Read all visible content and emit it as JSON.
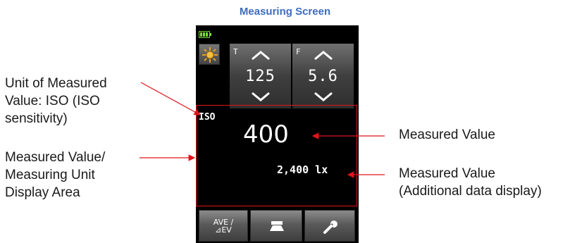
{
  "header": {
    "title": "Measuring Screen"
  },
  "callouts": {
    "unit_label": [
      "Unit of Measured",
      "Value: ISO (ISO",
      "sensitivity)"
    ],
    "display_area": [
      "Measured Value/",
      "Measuring Unit",
      "Display Area"
    ],
    "measured_value": "Measured Value",
    "additional": [
      "Measured Value",
      "(Additional data display)"
    ]
  },
  "device": {
    "shutter": {
      "label": "T",
      "value": "125"
    },
    "aperture": {
      "label": "F",
      "value": "5.6"
    },
    "unit": "ISO",
    "measured_value": "400",
    "additional_value": "2,400 lx",
    "buttons": {
      "mode_line1": "AVE /",
      "mode_line2": "⊿EV"
    }
  },
  "colors": {
    "title": "#3d6cc0",
    "callout_line": "#e0151a",
    "battery": "#7bdc3a"
  },
  "icons": [
    "battery-icon",
    "sun-icon",
    "up-arrow-icon",
    "down-arrow-icon",
    "meter-icon",
    "wrench-icon"
  ]
}
